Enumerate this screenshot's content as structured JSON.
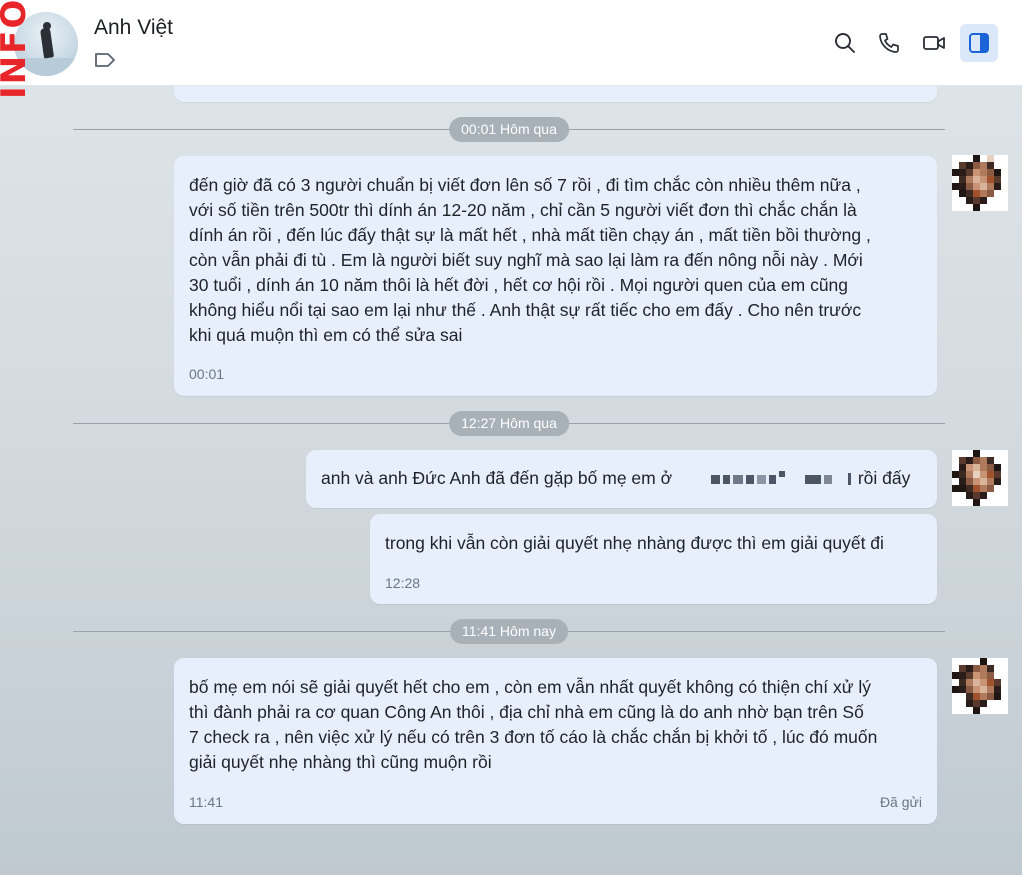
{
  "header": {
    "contact_name": "Anh Việt",
    "watermark": "INFO",
    "icons": [
      "search-icon",
      "phone-icon",
      "video-call-icon",
      "sidebar-toggle-icon"
    ],
    "active_color": "#dbe7fb"
  },
  "dividers": [
    {
      "label": "00:01 Hôm qua"
    },
    {
      "label": "12:27 Hôm qua"
    },
    {
      "label": "11:41 Hôm nay"
    }
  ],
  "messages": [
    {
      "lines": [
        "đến giờ đã có 3 người chuẩn bị viết đơn lên số 7 rồi , đi tìm chắc còn nhiều thêm nữa ,",
        "với số tiền trên 500tr thì dính án 12-20 năm , chỉ cần 5 người viết đơn thì chắc chắn là",
        "dính án rồi , đến lúc đấy thật sự là mất hết , nhà mất tiền chạy án , mất tiền bồi thường ,",
        "còn vẫn phải đi tù . Em là người biết suy nghĩ mà sao lại làm ra đến nông nỗi này . Mới",
        "30 tuổi , dính án 10 năm thôi là hết đời , hết cơ hội rồi . Mọi người quen của em cũng",
        "không hiểu nổi tại sao em lại như thế . Anh thật sự rất tiếc cho em đấy . Cho nên trước",
        "khi quá muộn thì em có thể sửa sai"
      ],
      "time": "00:01"
    },
    {
      "text_before": "anh và anh Đức Anh đã đến gặp bố mẹ em ở",
      "text_after": "rồi đấy"
    },
    {
      "text": "trong khi vẫn còn giải quyết nhẹ nhàng được thì em giải quyết đi",
      "time": "12:28"
    },
    {
      "lines": [
        "bố mẹ em nói sẽ giải quyết hết cho em , còn em vẫn nhất quyết không có thiện chí xử lý",
        "thì đành phải ra cơ quan Công An thôi , địa chỉ nhà em cũng là do anh nhờ bạn trên Số",
        "7 check ra , nên việc xử lý nếu có trên 3 đơn tố cáo là chắc chắn bị khởi tố , lúc đó muốn",
        "giải quyết nhẹ nhàng thì cũng muộn rồi"
      ],
      "time": "11:41",
      "status": "Đã gửi"
    }
  ]
}
